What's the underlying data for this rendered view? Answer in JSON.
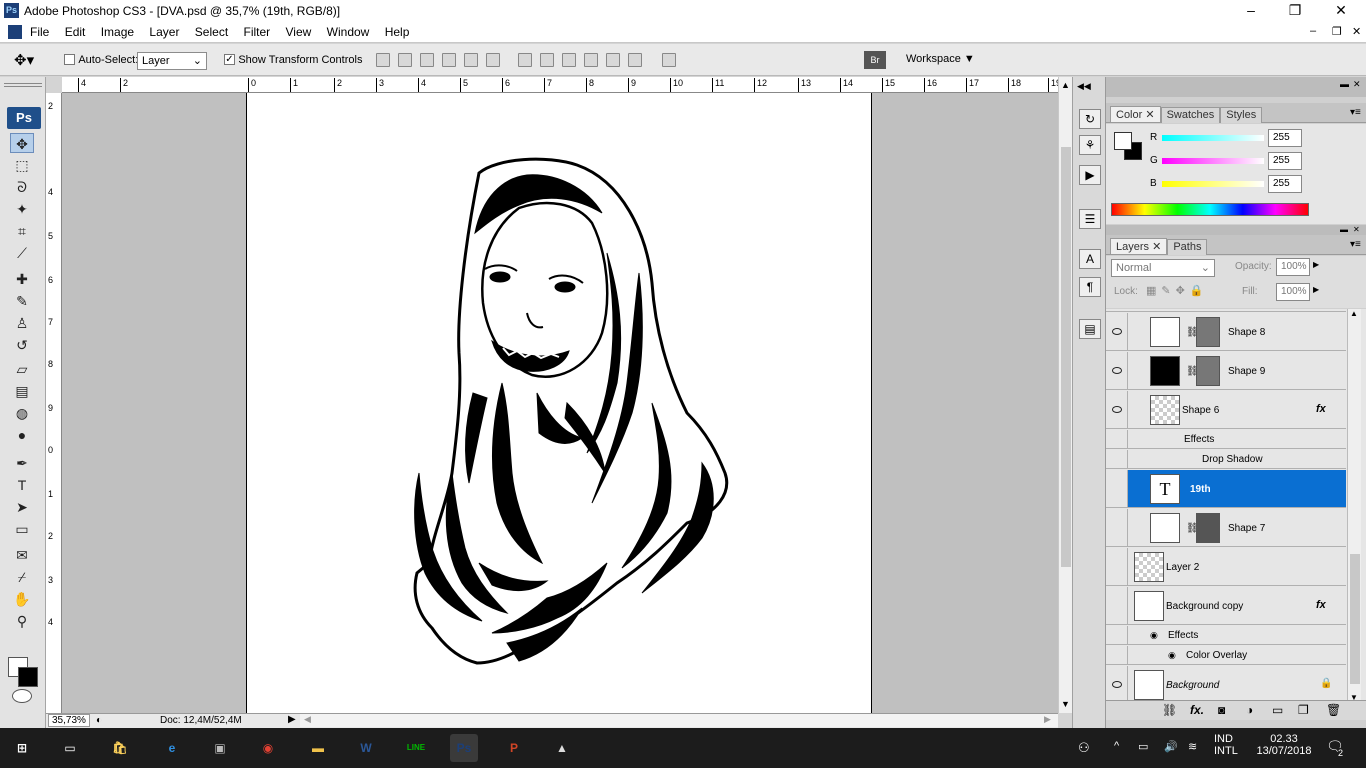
{
  "window": {
    "title": "Adobe Photoshop CS3 - [DVA.psd @ 35,7% (19th, RGB/8)]",
    "app_icon": "ps-icon"
  },
  "menu": [
    "File",
    "Edit",
    "Image",
    "Layer",
    "Select",
    "Filter",
    "View",
    "Window",
    "Help"
  ],
  "options": {
    "auto_select_label": "Auto-Select:",
    "auto_select_value": "Layer",
    "show_transform_label": "Show Transform Controls",
    "workspace_label": "Workspace"
  },
  "toolbox": {
    "badge": "Ps",
    "tools": [
      "move-tool-icon",
      "marquee-tool-icon",
      "lasso-tool-icon",
      "magic-wand-icon",
      "crop-tool-icon",
      "slice-tool-icon",
      "healing-brush-icon",
      "brush-tool-icon",
      "clone-stamp-icon",
      "history-brush-icon",
      "eraser-icon",
      "gradient-tool-icon",
      "blur-tool-icon",
      "dodge-tool-icon",
      "pen-tool-icon",
      "type-tool-icon",
      "path-selection-icon",
      "shape-tool-icon",
      "notes-tool-icon",
      "eyedropper-icon",
      "hand-tool-icon",
      "zoom-tool-icon"
    ]
  },
  "ruler_top": [
    "4",
    "2",
    "0",
    "1",
    "2",
    "3",
    "4",
    "5",
    "6",
    "7",
    "8",
    "9",
    "10",
    "11",
    "12",
    "13",
    "14",
    "15",
    "16",
    "17",
    "18",
    "19"
  ],
  "ruler_left": [
    "2",
    "4",
    "5",
    "6",
    "7",
    "8",
    "9",
    "0",
    "1",
    "2",
    "3",
    "4"
  ],
  "status": {
    "zoom": "35,73%",
    "doc_size": "Doc: 12,4M/52,4M"
  },
  "color_panel": {
    "tabs": [
      "Color",
      "Swatches",
      "Styles"
    ],
    "channels": [
      {
        "label": "R",
        "value": "255"
      },
      {
        "label": "G",
        "value": "255"
      },
      {
        "label": "B",
        "value": "255"
      }
    ]
  },
  "layers_panel": {
    "tabs": [
      "Layers",
      "Paths"
    ],
    "blend_mode": "Normal",
    "opacity_label": "Opacity:",
    "opacity_value": "100%",
    "lock_label": "Lock:",
    "fill_label": "Fill:",
    "fill_value": "100%",
    "layers": [
      {
        "name": "Shape 8",
        "visible": true
      },
      {
        "name": "Shape 9",
        "visible": true
      },
      {
        "name": "Shape 6",
        "visible": true,
        "fx": "fx",
        "effects_label": "Effects",
        "effect": "Drop Shadow"
      },
      {
        "name": "19th",
        "visible": false,
        "selected": true,
        "thumb_text": "T"
      },
      {
        "name": "Shape 7",
        "visible": false
      },
      {
        "name": "Layer 2",
        "visible": false
      },
      {
        "name": "Background copy",
        "visible": false,
        "fx": "fx",
        "effects_label": "Effects",
        "effect": "Color Overlay"
      },
      {
        "name": "Background",
        "visible": true
      }
    ]
  },
  "taskbar": {
    "lang_1": "IND",
    "lang_2": "INTL",
    "time": "02.33",
    "date": "13/07/2018",
    "notifications": "2",
    "apps": [
      {
        "name": "start-button",
        "label": "⊞"
      },
      {
        "name": "task-view",
        "label": "▭"
      },
      {
        "name": "store",
        "label": "🛍"
      },
      {
        "name": "edge",
        "label": "e"
      },
      {
        "name": "photos",
        "label": "▣"
      },
      {
        "name": "chrome",
        "label": "◉"
      },
      {
        "name": "file-explorer",
        "label": "▬"
      },
      {
        "name": "word",
        "label": "W"
      },
      {
        "name": "line",
        "label": "LINE"
      },
      {
        "name": "photoshop",
        "label": "Ps"
      },
      {
        "name": "powerpoint",
        "label": "P"
      },
      {
        "name": "photos-app",
        "label": "▲"
      }
    ]
  }
}
